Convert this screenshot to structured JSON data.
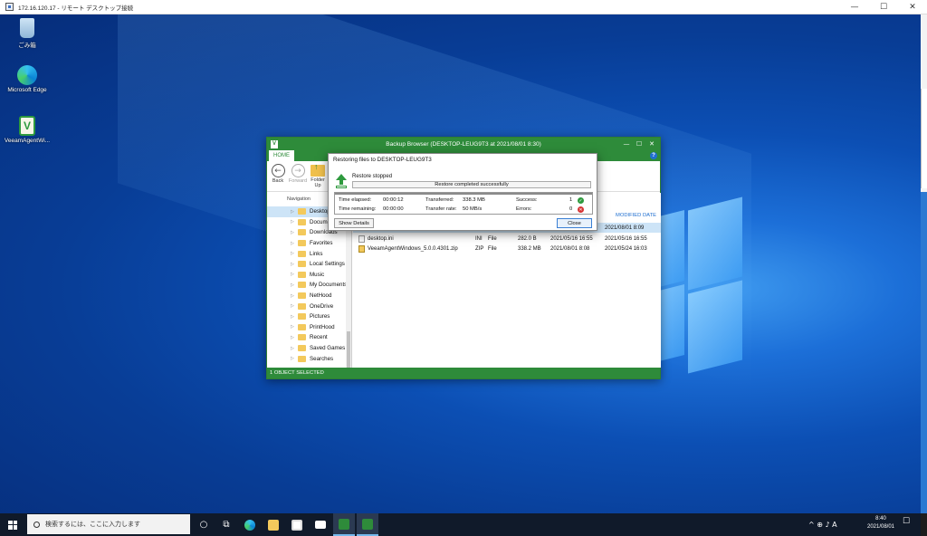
{
  "rdp": {
    "title": "172.16.120.17 - リモート デスクトップ接続",
    "minimize": "—",
    "maximize": "☐",
    "close": "✕"
  },
  "desktop_icons": [
    {
      "label": "ごみ箱",
      "icon": "recycle-bin-icon"
    },
    {
      "label": "Microsoft Edge",
      "icon": "edge-icon"
    },
    {
      "label": "VeeamAgentWi...",
      "icon": "veeam-icon"
    }
  ],
  "backup_browser": {
    "title": "Backup Browser (DESKTOP-LEUG9T3 at 2021/08/01 8:30)",
    "app_glyph": "V",
    "tab_home": "HOME",
    "help": "?",
    "ribbon": {
      "back": "Back",
      "forward": "Forward",
      "folder_up": "Folder Up"
    },
    "nav_header": "Navigation",
    "nav_items": [
      {
        "label": "Desktop",
        "selected": true
      },
      {
        "label": "Documents",
        "selected": false
      },
      {
        "label": "Downloads",
        "selected": false
      },
      {
        "label": "Favorites",
        "selected": false
      },
      {
        "label": "Links",
        "selected": false
      },
      {
        "label": "Local Settings",
        "selected": false
      },
      {
        "label": "Music",
        "selected": false
      },
      {
        "label": "My Documents",
        "selected": false
      },
      {
        "label": "NetHood",
        "selected": false
      },
      {
        "label": "OneDrive",
        "selected": false
      },
      {
        "label": "Pictures",
        "selected": false
      },
      {
        "label": "PrintHood",
        "selected": false
      },
      {
        "label": "Recent",
        "selected": false
      },
      {
        "label": "Saved Games",
        "selected": false
      },
      {
        "label": "Searches",
        "selected": false
      }
    ],
    "list_header_modified": "MODIFIED DATE",
    "rows": [
      {
        "name": "",
        "ext": "",
        "type": "",
        "size": "",
        "date1": "",
        "date2": "2021/08/01 8:09",
        "selected": true
      },
      {
        "name": "desktop.ini",
        "ext": "INI",
        "type": "File",
        "size": "282.0 B",
        "date1": "2021/05/16 16:55",
        "date2": "2021/05/16 16:55",
        "selected": false
      },
      {
        "name": "VeeamAgentWindows_5.0.0.4301.zip",
        "ext": "ZIP",
        "type": "File",
        "size": "338.2 MB",
        "date1": "2021/08/01 8:08",
        "date2": "2021/05/24 16:03",
        "selected": false
      }
    ],
    "status": "1 OBJECT SELECTED"
  },
  "restore_dialog": {
    "title": "Restoring files to DESKTOP-LEUG9T3",
    "stopped": "Restore stopped",
    "progress_text": "Restore completed successfully",
    "time_elapsed_label": "Time elapsed:",
    "time_elapsed": "00:00:12",
    "time_remaining_label": "Time remaining:",
    "time_remaining": "00:00:00",
    "transferred_label": "Transferred:",
    "transferred": "338.3 MB",
    "transfer_rate_label": "Transfer rate:",
    "transfer_rate": "50 MB/s",
    "success_label": "Success:",
    "success": "1",
    "errors_label": "Errors:",
    "errors": "0",
    "show_details": "Show Details",
    "close": "Close"
  },
  "taskbar": {
    "search_placeholder": "検索するには、ここに入力します",
    "tray_symbols": "^ ⊕ ♪ A",
    "time": "8:40",
    "date": "2021/08/01",
    "notification": "☐"
  },
  "colors": {
    "veeam_green": "#2e8b3a",
    "selection": "#cde4f7",
    "link_blue": "#1f6fd0"
  }
}
